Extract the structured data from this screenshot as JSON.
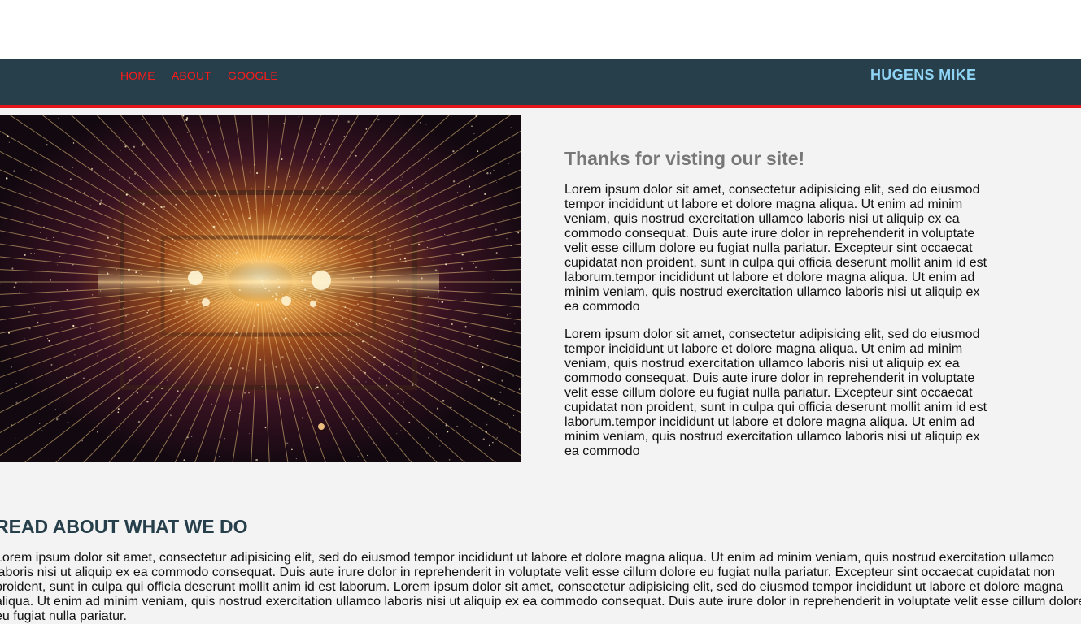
{
  "nav": {
    "links": [
      "HOME",
      "ABOUT",
      "GOOGLE"
    ],
    "brand": "HUGENS MIKE"
  },
  "intro": {
    "heading": "Thanks for visting our site!",
    "paragraphs": [
      "Lorem ipsum dolor sit amet, consectetur adipisicing elit, sed do eiusmod tempor incididunt ut labore et dolore magna aliqua. Ut enim ad minim veniam, quis nostrud exercitation ullamco laboris nisi ut aliquip ex ea commodo consequat. Duis aute irure dolor in reprehenderit in voluptate velit esse cillum dolore eu fugiat nulla pariatur. Excepteur sint occaecat cupidatat non proident, sunt in culpa qui officia deserunt mollit anim id est laborum.tempor incididunt ut labore et dolore magna aliqua. Ut enim ad minim veniam, quis nostrud exercitation ullamco laboris nisi ut aliquip ex ea commodo",
      "Lorem ipsum dolor sit amet, consectetur adipisicing elit, sed do eiusmod tempor incididunt ut labore et dolore magna aliqua. Ut enim ad minim veniam, quis nostrud exercitation ullamco laboris nisi ut aliquip ex ea commodo consequat. Duis aute irure dolor in reprehenderit in voluptate velit esse cillum dolore eu fugiat nulla pariatur. Excepteur sint occaecat cupidatat non proident, sunt in culpa qui officia deserunt mollit anim id est laborum.tempor incididunt ut labore et dolore magna aliqua. Ut enim ad minim veniam, quis nostrud exercitation ullamco laboris nisi ut aliquip ex ea commodo"
    ]
  },
  "about": {
    "heading": "READ ABOUT WHAT WE DO",
    "text": "Lorem ipsum dolor sit amet, consectetur adipisicing elit, sed do eiusmod tempor incididunt ut labore et dolore magna aliqua. Ut enim ad minim veniam, quis nostrud exercitation ullamco laboris nisi ut aliquip ex ea commodo consequat. Duis aute irure dolor in reprehenderit in voluptate velit esse cillum dolore eu fugiat nulla pariatur. Excepteur sint occaecat cupidatat non proident, sunt in culpa qui officia deserunt mollit anim id est laborum. Lorem ipsum dolor sit amet, consectetur adipisicing elit, sed do eiusmod tempor incididunt ut labore et dolore magna aliqua. Ut enim ad minim veniam, quis nostrud exercitation ullamco laboris nisi ut aliquip ex ea commodo consequat. Duis aute irure dolor in reprehenderit in voluptate velit esse cillum dolore eu fugiat nulla pariatur."
  },
  "colors": {
    "nav_bg": "#263f4a",
    "accent_red": "#e2161b",
    "link_red": "#ff1a1a",
    "brand_blue": "#8fd3f5",
    "page_bg": "#f3f3f3"
  }
}
